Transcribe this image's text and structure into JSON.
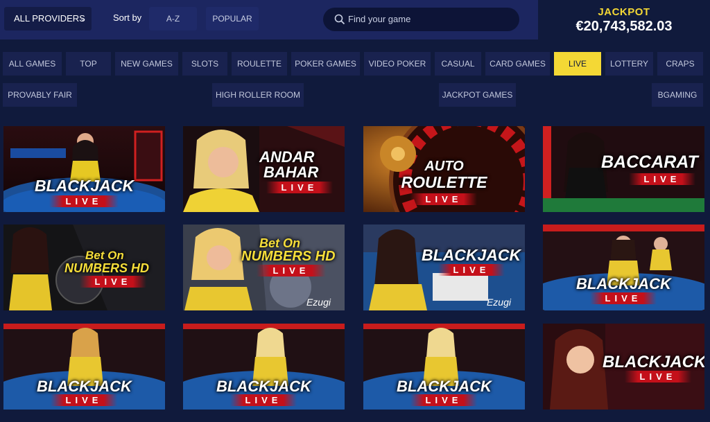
{
  "header": {
    "provider_select": "ALL PROVIDERS",
    "sort_label": "Sort by",
    "sort_options": [
      "A-Z",
      "POPULAR"
    ],
    "search_placeholder": "Find your game",
    "jackpot_label": "JACKPOT",
    "jackpot_amount": "€20,743,582.03"
  },
  "tabs_row1": [
    "ALL GAMES",
    "TOP",
    "NEW GAMES",
    "SLOTS",
    "ROULETTE",
    "POKER GAMES",
    "VIDEO POKER",
    "CASUAL",
    "CARD GAMES",
    "LIVE",
    "LOTTERY",
    "CRAPS"
  ],
  "tabs_row2": [
    "PROVABLY FAIR",
    "HIGH ROLLER ROOM",
    "JACKPOT GAMES",
    "BGAMING"
  ],
  "active_tab": "LIVE",
  "colors": {
    "accent_yellow": "#f4d835",
    "background": "#101a3c",
    "topbar": "#1c2660",
    "live_red": "#c4101a"
  },
  "games": [
    {
      "title": "BLACKJACK",
      "live": "LIVE",
      "theme": "table"
    },
    {
      "title_l1": "ANDAR",
      "title_l2": "BAHAR",
      "live": "LIVE",
      "theme": "dealer"
    },
    {
      "title_l1": "AUTO",
      "title_l2": "ROULETTE",
      "live": "LIVE",
      "theme": "roulette"
    },
    {
      "title": "BACCARAT",
      "live": "LIVE",
      "theme": "dealer"
    },
    {
      "title_l1": "Bet On",
      "title_l2": "NUMBERS HD",
      "live": "LIVE",
      "theme": "dark"
    },
    {
      "title_l1": "Bet On",
      "title_l2": "NUMBERS HD",
      "live": "LIVE",
      "brand": "Ezugi",
      "theme": "dealer"
    },
    {
      "title": "BLACKJACK",
      "live": "LIVE",
      "brand": "Ezugi",
      "theme": "blue"
    },
    {
      "title": "BLACKJACK",
      "live": "LIVE",
      "theme": "table"
    },
    {
      "title": "BLACKJACK",
      "live": "LIVE",
      "theme": "table"
    },
    {
      "title": "BLACKJACK",
      "live": "LIVE",
      "theme": "table"
    },
    {
      "title": "BLACKJACK",
      "live": "LIVE",
      "theme": "table"
    },
    {
      "title": "BLACKJACK",
      "live": "LIVE",
      "theme": "dealer"
    }
  ]
}
